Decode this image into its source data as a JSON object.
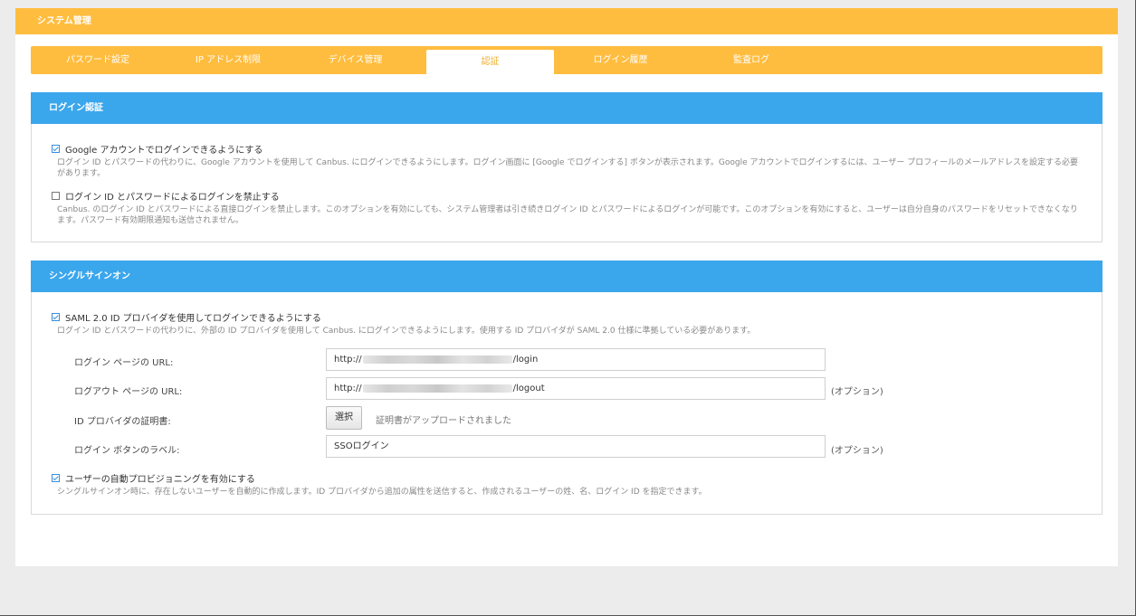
{
  "header": {
    "title": "システム管理"
  },
  "tabs": [
    {
      "label": "パスワード設定"
    },
    {
      "label": "IP アドレス制限"
    },
    {
      "label": "デバイス管理"
    },
    {
      "label": "認証",
      "active": true
    },
    {
      "label": "ログイン履歴"
    },
    {
      "label": "監査ログ"
    }
  ],
  "login_auth": {
    "title": "ログイン認証",
    "google": {
      "checked": true,
      "label": "Google アカウントでログインできるようにする",
      "desc": "ログイン ID とパスワードの代わりに、Google アカウントを使用して Canbus. にログインできるようにします。ログイン画面に [Google でログインする] ボタンが表示されます。Google アカウントでログインするには、ユーザー プロフィールのメールアドレスを設定する必要があります。"
    },
    "disable_pw": {
      "checked": false,
      "label": "ログイン ID とパスワードによるログインを禁止する",
      "desc": "Canbus. のログイン ID とパスワードによる直接ログインを禁止します。このオプションを有効にしても、システム管理者は引き続きログイン ID とパスワードによるログインが可能です。このオプションを有効にすると、ユーザーは自分自身のパスワードをリセットできなくなります。パスワード有効期限通知も送信されません。"
    }
  },
  "sso": {
    "title": "シングルサインオン",
    "saml": {
      "checked": true,
      "label": "SAML 2.0 ID プロバイダを使用してログインできるようにする",
      "desc": "ログイン ID とパスワードの代わりに、外部の ID プロバイダを使用して Canbus. にログインできるようにします。使用する ID プロバイダが SAML 2.0 仕様に準拠している必要があります。"
    },
    "login_url": {
      "label": "ログイン ページの URL:",
      "prefix": "http://",
      "suffix": "/login"
    },
    "logout_url": {
      "label": "ログアウト ページの URL:",
      "prefix": "http://",
      "suffix": "/logout",
      "note": "(オプション)"
    },
    "cert": {
      "label": "ID プロバイダの証明書:",
      "button": "選択",
      "status": "証明書がアップロードされました"
    },
    "button_label": {
      "label": "ログイン ボタンのラベル:",
      "value": "SSOログイン",
      "note": "(オプション)"
    },
    "provision": {
      "checked": true,
      "label": "ユーザーの自動プロビジョニングを有効にする",
      "desc": "シングルサインオン時に、存在しないユーザーを自動的に作成します。ID プロバイダから追加の属性を送信すると、作成されるユーザーの姓、名、ログイン ID を指定できます。"
    }
  }
}
